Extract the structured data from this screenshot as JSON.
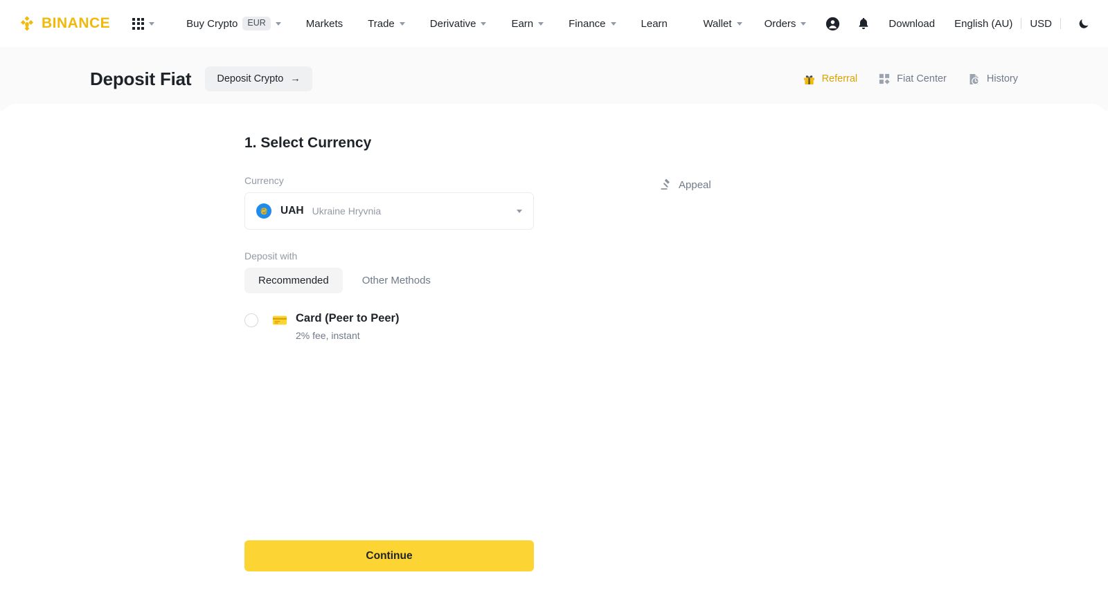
{
  "brand": {
    "name": "BINANCE",
    "accent": "#F0B90B",
    "button_yellow": "#FCD535"
  },
  "topnav": {
    "items": [
      {
        "label": "Buy Crypto",
        "badge": "EUR",
        "has_caret": true
      },
      {
        "label": "Markets",
        "has_caret": false
      },
      {
        "label": "Trade",
        "has_caret": true
      },
      {
        "label": "Derivative",
        "has_caret": true
      },
      {
        "label": "Earn",
        "has_caret": true
      },
      {
        "label": "Finance",
        "has_caret": true
      },
      {
        "label": "Learn",
        "has_caret": false
      }
    ],
    "right": {
      "wallet": "Wallet",
      "orders": "Orders",
      "download": "Download",
      "language": "English (AU)",
      "currency": "USD",
      "profile_icon": "user-circle-icon",
      "notification_icon": "bell-icon",
      "theme_icon": "moon-icon",
      "apps_icon": "grid-apps-icon"
    }
  },
  "subheader": {
    "title": "Deposit Fiat",
    "switch_button": "Deposit Crypto",
    "switch_arrow": "→",
    "links": [
      {
        "label": "Referral",
        "icon": "gift-icon"
      },
      {
        "label": "Fiat Center",
        "icon": "dashboard-squares-icon"
      },
      {
        "label": "History",
        "icon": "document-clock-icon"
      }
    ]
  },
  "main": {
    "step_title": "1. Select Currency",
    "currency_label": "Currency",
    "currency": {
      "code": "UAH",
      "name": "Ukraine Hryvnia",
      "symbol": "₴",
      "icon_bg": "#1f8ced",
      "icon_fg": "#F0B90B"
    },
    "deposit_with_label": "Deposit with",
    "tabs": [
      {
        "label": "Recommended",
        "active": true
      },
      {
        "label": "Other Methods",
        "active": false
      }
    ],
    "methods": [
      {
        "name": "Card (Peer to Peer)",
        "detail": "2% fee, instant",
        "icon": "credit-card-icon",
        "selected": false
      }
    ],
    "appeal": {
      "label": "Appeal",
      "icon": "gavel-icon"
    },
    "continue_label": "Continue"
  }
}
